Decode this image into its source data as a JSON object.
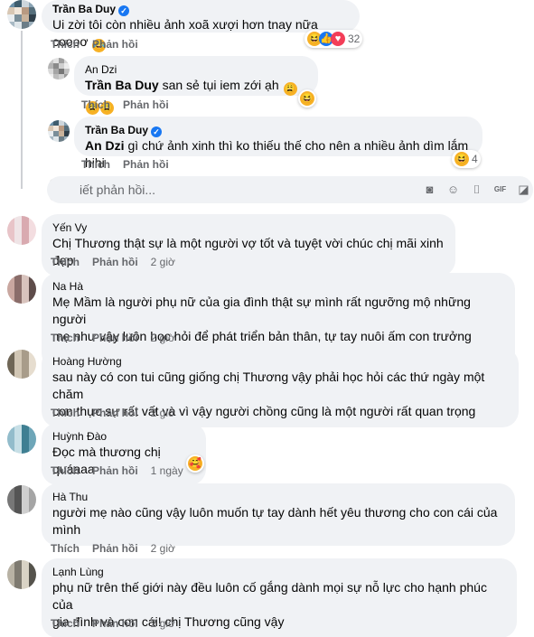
{
  "actions": {
    "like": "Thích",
    "reply": "Phản hồi"
  },
  "top_comment": {
    "author": "Trần Ba Duy",
    "text": "Ui zời tôi còn nhiều ảnh xoã xượi hơn tnay nữa coooơ",
    "reaction_count": "32"
  },
  "replies": [
    {
      "author": "An Dzi",
      "mention": "Trần Ba Duy",
      "text": "san sẻ tụi iem zới ạh"
    },
    {
      "author": "Trần Ba Duy",
      "mention": "An Dzi",
      "text": "gì chứ ảnh xinh thì ko thiếu thế cho nên a nhiều ảnh dìm lắm hihi",
      "reaction_count": "4"
    }
  ],
  "reply_box": {
    "placeholder": "iết phản hồi..."
  },
  "comments": [
    {
      "author": "Yến Vy",
      "lines": [
        "Chị Thương thật sự là một người vợ tốt và tuyệt vời chúc chị mãi xinh đẹp"
      ],
      "time": "2 giờ"
    },
    {
      "author": "Na Hà",
      "lines": [
        "Mẹ Mầm là người phụ nữ của gia đình thật sự mình rất ngưỡng mộ những người",
        "mẹ như vậy luôn học hỏi để phát triển bản thân, tự tay nuôi ấm con trưởng thành"
      ],
      "time": "2 giờ"
    },
    {
      "author": "Hoàng Hường",
      "lines": [
        "sau này có con tui cũng giống chị Thương vậy phải học hỏi các thứ ngày một chăm",
        "con thực sự rất vất và vì vậy người chồng cũng là một người rất quan trọng"
      ],
      "time": "2 giờ"
    },
    {
      "author": "Huỳnh Đào",
      "lines": [
        "Đọc mà thương chị quáaaa"
      ],
      "time": "1 ngày"
    },
    {
      "author": "Hà Thu",
      "lines": [
        "người mẹ nào cũng vậy luôn muốn tự tay dành hết yêu thương cho con cái của",
        "mình"
      ],
      "time": "2 giờ"
    },
    {
      "author": "Lạnh Lùng",
      "lines": [
        "phụ nữ trên thế giới này đều luôn cố gắng dành mọi sự nỗ lực cho hạnh phúc của",
        "gia đình và con cái! chị Thương cũng vậy"
      ],
      "time": "2 giờ"
    }
  ],
  "colors": {
    "bubble": "#f0f2f5",
    "meta": "#65676b",
    "verified": "#1877f2",
    "haha": "#f7b125",
    "love": "#f33e58"
  },
  "icons": [
    "verified-badge-icon",
    "haha-reaction-icon",
    "like-reaction-icon",
    "love-reaction-icon",
    "emoji-icon",
    "camera-icon",
    "gif-icon",
    "sticker-icon"
  ]
}
